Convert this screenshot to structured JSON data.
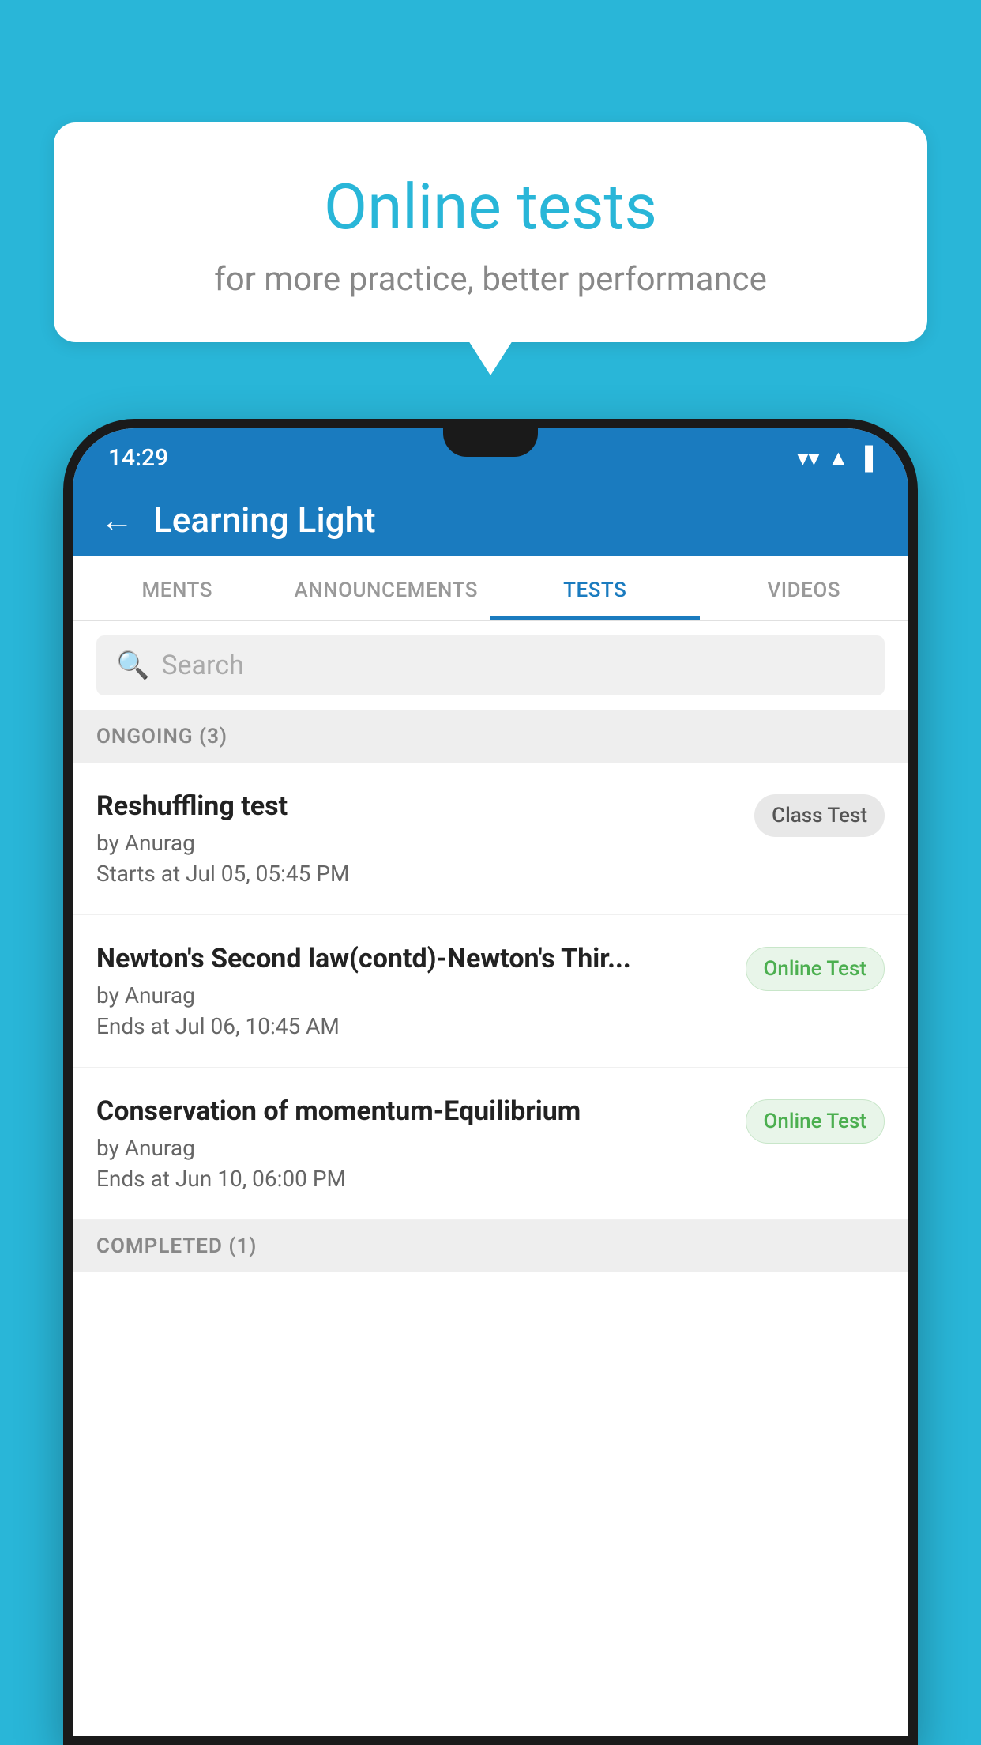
{
  "background_color": "#29b6d8",
  "bubble": {
    "title": "Online tests",
    "subtitle": "for more practice, better performance"
  },
  "status_bar": {
    "time": "14:29",
    "wifi_icon": "▼",
    "signal_icon": "▲",
    "battery_icon": "▌"
  },
  "app_bar": {
    "title": "Learning Light",
    "back_label": "←"
  },
  "tabs": [
    {
      "label": "MENTS",
      "active": false
    },
    {
      "label": "ANNOUNCEMENTS",
      "active": false
    },
    {
      "label": "TESTS",
      "active": true
    },
    {
      "label": "VIDEOS",
      "active": false
    }
  ],
  "search": {
    "placeholder": "Search"
  },
  "ongoing_section": {
    "label": "ONGOING (3)"
  },
  "tests": [
    {
      "name": "Reshuffling test",
      "author": "by Anurag",
      "date_label": "Starts at",
      "date": "Jul 05, 05:45 PM",
      "badge": "Class Test",
      "badge_type": "class"
    },
    {
      "name": "Newton's Second law(contd)-Newton's Thir...",
      "author": "by Anurag",
      "date_label": "Ends at",
      "date": "Jul 06, 10:45 AM",
      "badge": "Online Test",
      "badge_type": "online"
    },
    {
      "name": "Conservation of momentum-Equilibrium",
      "author": "by Anurag",
      "date_label": "Ends at",
      "date": "Jun 10, 06:00 PM",
      "badge": "Online Test",
      "badge_type": "online"
    }
  ],
  "completed_section": {
    "label": "COMPLETED (1)"
  }
}
